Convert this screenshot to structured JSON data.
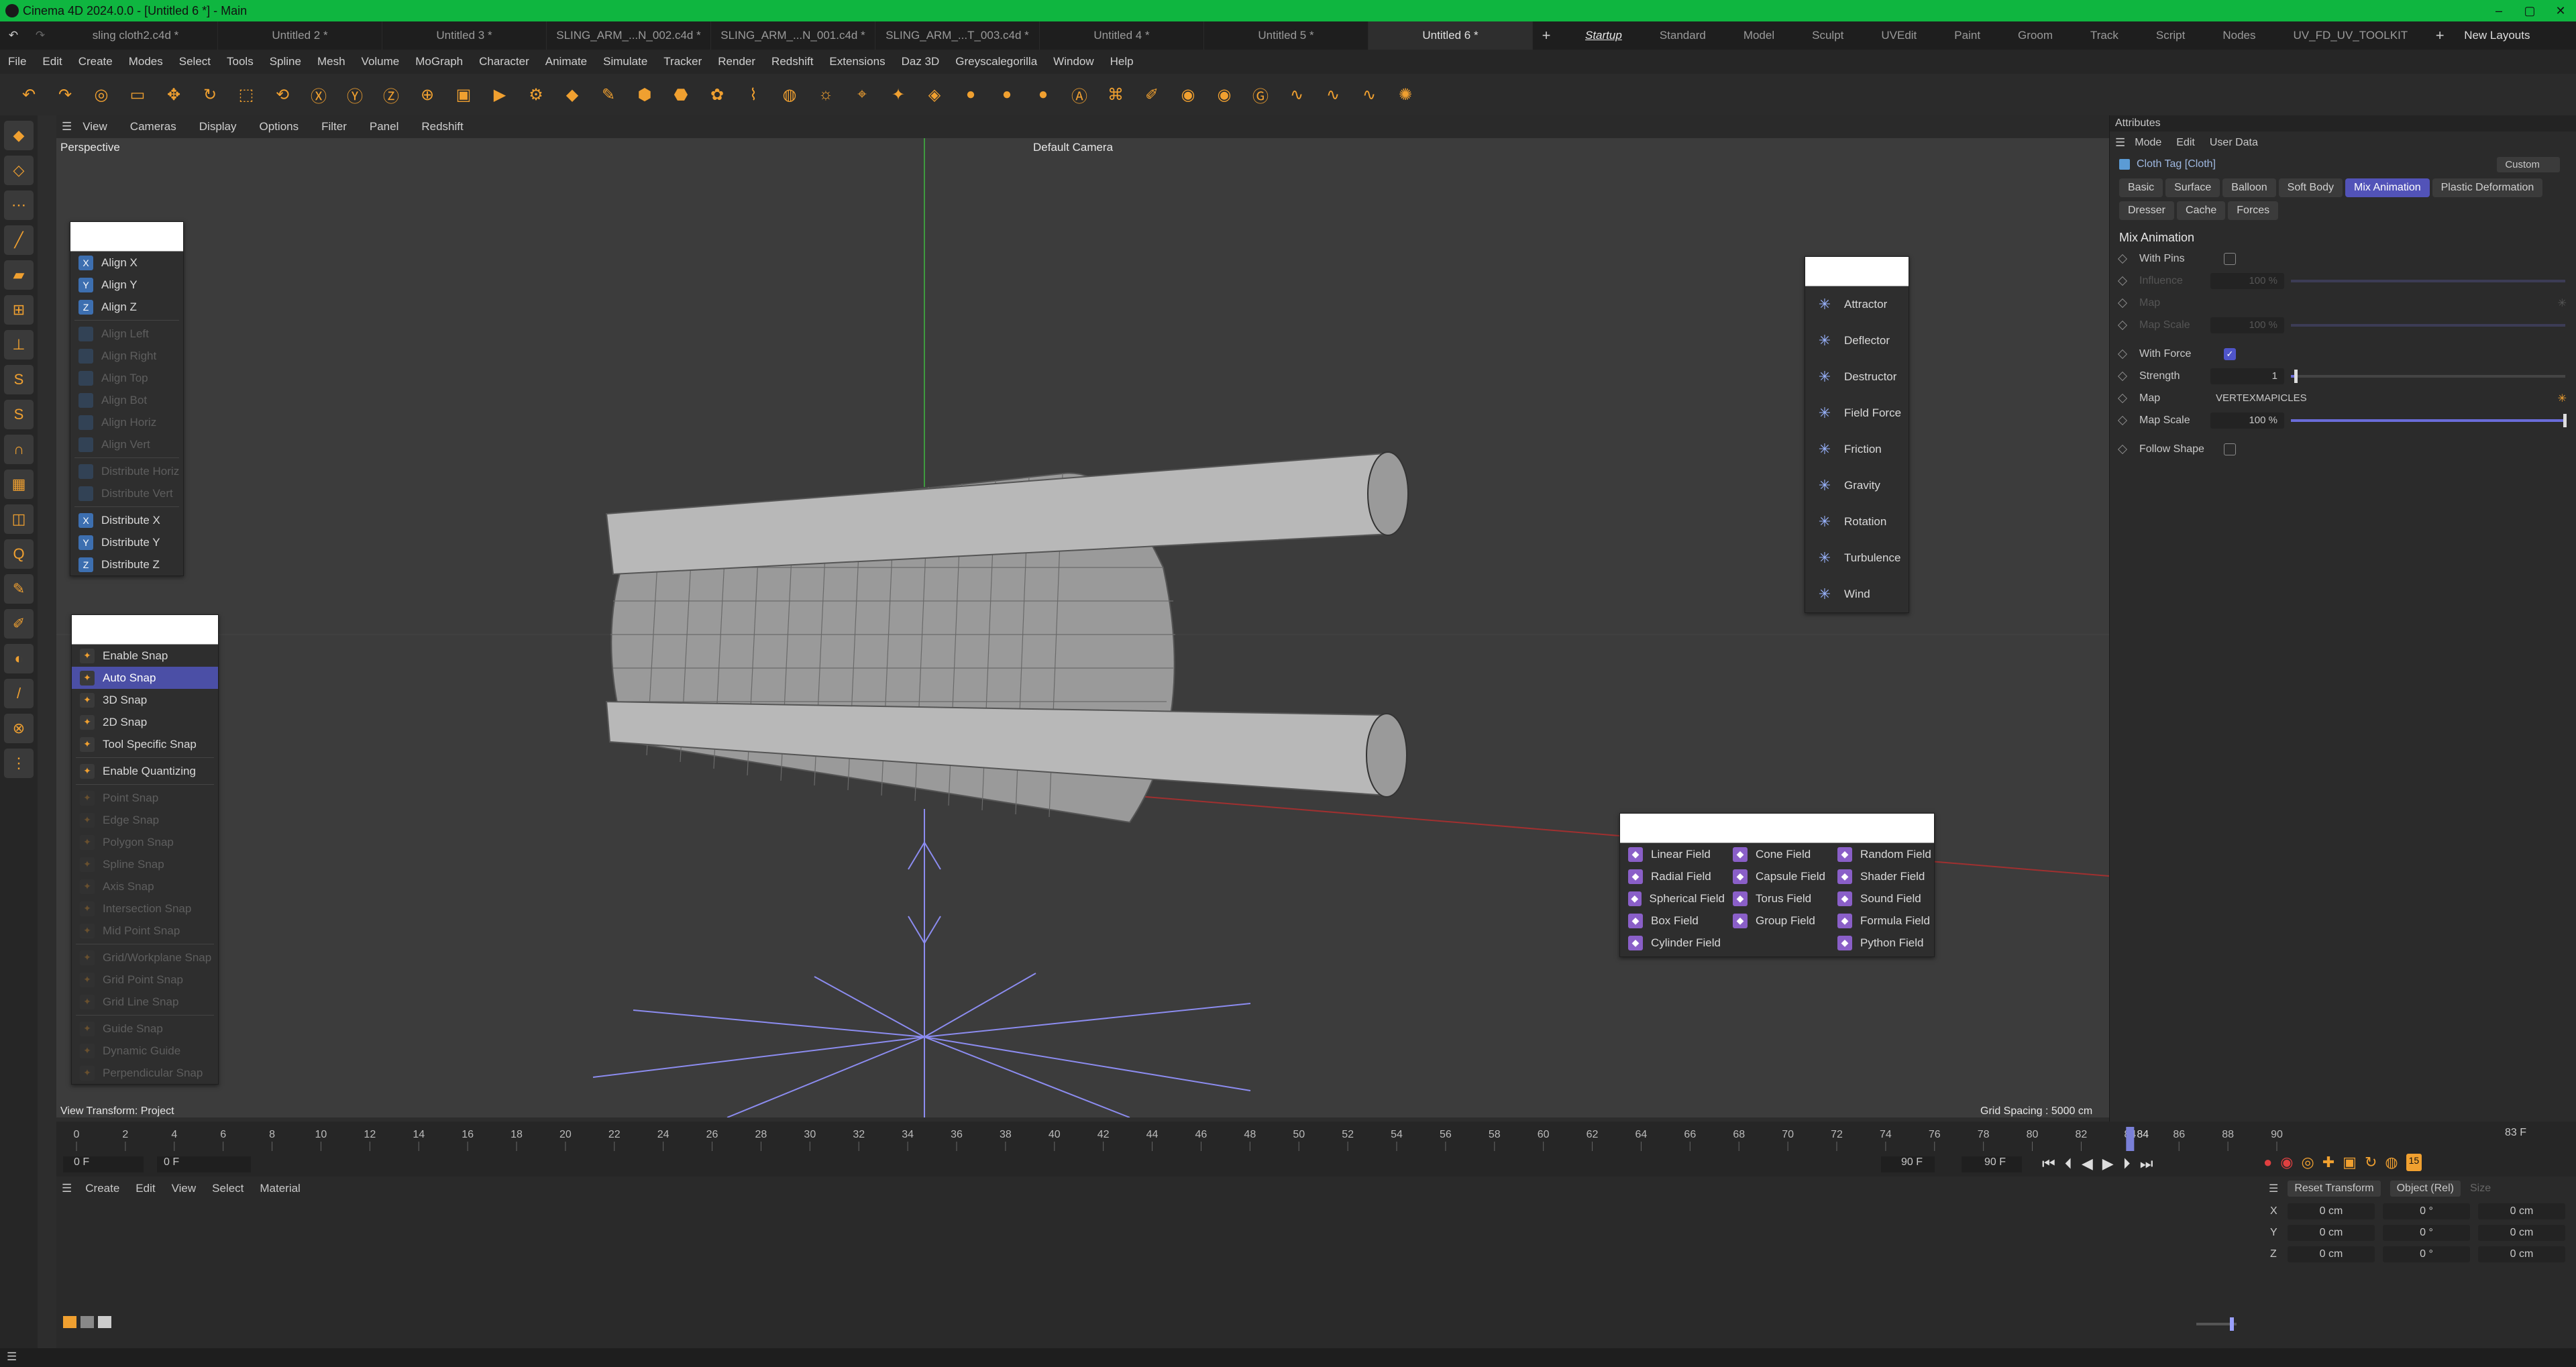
{
  "window": {
    "title": "Cinema 4D 2024.0.0 - [Untitled 6 *] - Main"
  },
  "doc_tabs": [
    {
      "label": "sling cloth2.c4d *",
      "active": false
    },
    {
      "label": "Untitled 2 *",
      "active": false
    },
    {
      "label": "Untitled 3 *",
      "active": false
    },
    {
      "label": "SLING_ARM_...N_002.c4d *",
      "active": false
    },
    {
      "label": "SLING_ARM_...N_001.c4d *",
      "active": false
    },
    {
      "label": "SLING_ARM_...T_003.c4d *",
      "active": false
    },
    {
      "label": "Untitled 4 *",
      "active": false
    },
    {
      "label": "Untitled 5 *",
      "active": false
    },
    {
      "label": "Untitled 6 *",
      "active": true
    }
  ],
  "layout_tabs": [
    "Startup",
    "Standard",
    "Model",
    "Sculpt",
    "UVEdit",
    "Paint",
    "Groom",
    "Track",
    "Script",
    "Nodes",
    "UV_FD_UV_TOOLKIT"
  ],
  "new_layouts": "New Layouts",
  "menus": [
    "File",
    "Edit",
    "Create",
    "Modes",
    "Select",
    "Tools",
    "Spline",
    "Mesh",
    "Volume",
    "MoGraph",
    "Character",
    "Animate",
    "Simulate",
    "Tracker",
    "Render",
    "Redshift",
    "Extensions",
    "Daz 3D",
    "Greyscalegorilla",
    "Window",
    "Help"
  ],
  "viewport_menu": [
    "View",
    "Cameras",
    "Display",
    "Options",
    "Filter",
    "Panel",
    "Redshift"
  ],
  "viewport": {
    "name": "Perspective",
    "camera": "Default Camera",
    "view_transform": "View Transform: Project",
    "grid_spacing": "Grid Spacing : 5000 cm"
  },
  "align_panel": {
    "items": [
      {
        "label": "Align X",
        "enabled": true,
        "icon": "X"
      },
      {
        "label": "Align Y",
        "enabled": true,
        "icon": "Y"
      },
      {
        "label": "Align Z",
        "enabled": true,
        "icon": "Z"
      },
      {
        "label": "Align Left",
        "enabled": false
      },
      {
        "label": "Align Right",
        "enabled": false
      },
      {
        "label": "Align Top",
        "enabled": false
      },
      {
        "label": "Align Bot",
        "enabled": false
      },
      {
        "label": "Align Horiz",
        "enabled": false
      },
      {
        "label": "Align Vert",
        "enabled": false
      },
      {
        "label": "Distribute Horiz",
        "enabled": false
      },
      {
        "label": "Distribute Vert",
        "enabled": false
      },
      {
        "label": "Distribute X",
        "enabled": true,
        "icon": "X"
      },
      {
        "label": "Distribute Y",
        "enabled": true,
        "icon": "Y"
      },
      {
        "label": "Distribute Z",
        "enabled": true,
        "icon": "Z"
      }
    ]
  },
  "snap_panel": {
    "items": [
      {
        "label": "Enable Snap",
        "enabled": true
      },
      {
        "label": "Auto Snap",
        "enabled": true,
        "selected": true
      },
      {
        "label": "3D Snap",
        "enabled": true
      },
      {
        "label": "2D Snap",
        "enabled": true
      },
      {
        "label": "Tool Specific Snap",
        "enabled": true
      },
      {
        "label": "Enable Quantizing",
        "enabled": true
      },
      {
        "label": "Point Snap",
        "enabled": false
      },
      {
        "label": "Edge Snap",
        "enabled": false
      },
      {
        "label": "Polygon Snap",
        "enabled": false
      },
      {
        "label": "Spline Snap",
        "enabled": false
      },
      {
        "label": "Axis Snap",
        "enabled": false
      },
      {
        "label": "Intersection Snap",
        "enabled": false
      },
      {
        "label": "Mid Point Snap",
        "enabled": false
      },
      {
        "label": "Grid/Workplane Snap",
        "enabled": false
      },
      {
        "label": "Grid Point Snap",
        "enabled": false
      },
      {
        "label": "Grid Line Snap",
        "enabled": false
      },
      {
        "label": "Guide Snap",
        "enabled": false
      },
      {
        "label": "Dynamic Guide",
        "enabled": false
      },
      {
        "label": "Perpendicular Snap",
        "enabled": false
      }
    ]
  },
  "force_panel": {
    "items": [
      "Attractor",
      "Deflector",
      "Destructor",
      "Field Force",
      "Friction",
      "Gravity",
      "Rotation",
      "Turbulence",
      "Wind"
    ]
  },
  "field_panel": {
    "columns": [
      [
        "Linear Field",
        "Radial Field",
        "Spherical Field",
        "Box Field",
        "Cylinder Field"
      ],
      [
        "Cone Field",
        "Capsule Field",
        "Torus Field",
        "Group Field"
      ],
      [
        "Random Field",
        "Shader Field",
        "Sound Field",
        "Formula Field",
        "Python Field"
      ]
    ]
  },
  "attributes": {
    "header": "Attributes",
    "menu": [
      "Mode",
      "Edit",
      "User Data"
    ],
    "object": "Cloth Tag [Cloth]",
    "preset": "Custom",
    "tabs_row1": [
      "Basic",
      "Surface",
      "Balloon",
      "Soft Body",
      "Mix Animation",
      "Plastic Deformation"
    ],
    "tabs_row2": [
      "Dresser",
      "Cache",
      "Forces"
    ],
    "active_tab": "Mix Animation",
    "section": "Mix Animation",
    "rows": [
      {
        "label": "With Pins",
        "type": "check",
        "checked": false,
        "dim": false
      },
      {
        "label": "Influence",
        "type": "slider",
        "value": "100 %",
        "fill": 1.0,
        "dim": true
      },
      {
        "label": "Map",
        "type": "map",
        "value": "",
        "dim": true
      },
      {
        "label": "Map Scale",
        "type": "slider",
        "value": "100 %",
        "fill": 1.0,
        "dim": true
      },
      {
        "label": "With Force",
        "type": "check",
        "checked": true,
        "dim": false
      },
      {
        "label": "Strength",
        "type": "slider",
        "value": "1",
        "fill": 0.02,
        "dim": false
      },
      {
        "label": "Map",
        "type": "map",
        "value": "VERTEXMAPICLES",
        "dim": false
      },
      {
        "label": "Map Scale",
        "type": "slider",
        "value": "100 %",
        "fill": 1.0,
        "dim": false
      },
      {
        "label": "Follow Shape",
        "type": "check",
        "checked": false,
        "dim": false
      }
    ]
  },
  "timeline": {
    "ticks": [
      "0",
      "2",
      "4",
      "6",
      "8",
      "10",
      "12",
      "14",
      "16",
      "18",
      "20",
      "22",
      "24",
      "26",
      "28",
      "30",
      "32",
      "34",
      "36",
      "38",
      "40",
      "42",
      "44",
      "46",
      "48",
      "50",
      "52",
      "54",
      "56",
      "58",
      "60",
      "62",
      "64",
      "66",
      "68",
      "70",
      "72",
      "74",
      "76",
      "78",
      "80",
      "82",
      "84",
      "86",
      "88",
      "90"
    ],
    "current_frame": "83 F",
    "start": "0 F",
    "start2": "0 F",
    "end": "90 F",
    "end2": "90 F",
    "marker": "84",
    "fps_badge": "15"
  },
  "material_menu": [
    "Create",
    "Edit",
    "View",
    "Select",
    "Material"
  ],
  "coords": {
    "reset": "Reset Transform",
    "mode": "Object (Rel)",
    "size": "Size",
    "rows": [
      {
        "axis": "X",
        "pos": "0 cm",
        "rot": "0 °",
        "size": "0 cm"
      },
      {
        "axis": "Y",
        "pos": "0 cm",
        "rot": "0 °",
        "size": "0 cm"
      },
      {
        "axis": "Z",
        "pos": "0 cm",
        "rot": "0 °",
        "size": "0 cm"
      }
    ]
  },
  "colors": {
    "accent": "#5253b8",
    "titlebar": "#0fb640",
    "orange": "#f0a030"
  }
}
